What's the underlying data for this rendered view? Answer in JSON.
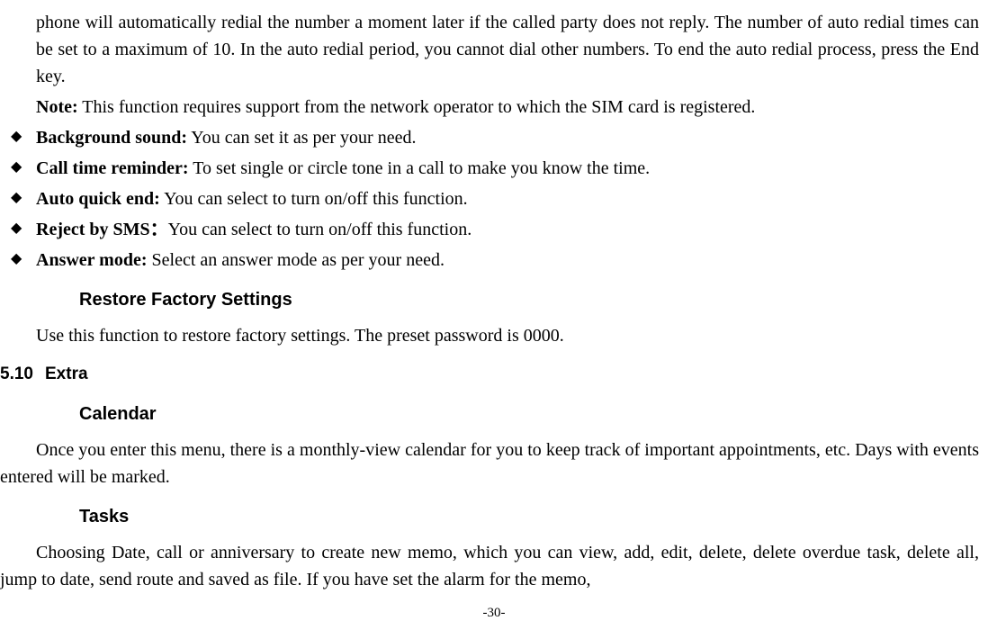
{
  "para1": "phone will automatically redial the number a moment later if the called party does not reply. The number of auto redial times can be set to a maximum of 10. In the auto redial period, you cannot dial other numbers. To end the auto redial process, press the End key.",
  "note_label": "Note:",
  "note_text": " This function requires support from the network operator to which the SIM card is registered.",
  "bullets": [
    {
      "label": "Background sound:",
      "text": " You can set it as per your need."
    },
    {
      "label": "Call time reminder:",
      "text": " To set single or circle tone in a call to make you know the time."
    },
    {
      "label": "Auto quick end:",
      "text": " You can select to turn on/off this function."
    },
    {
      "label": "Reject by SMS：",
      "text": "You can select to turn on/off this function."
    },
    {
      "label": "Answer mode:",
      "text": " Select an answer mode as per your need."
    }
  ],
  "heading_restore": "Restore Factory Settings",
  "restore_para": "Use this function to restore factory settings. The preset password is 0000.",
  "section_num": "5.10",
  "section_title": "Extra",
  "heading_calendar": "Calendar",
  "calendar_para": "Once you enter this menu, there is a monthly-view calendar for you to keep track of important appointments, etc. Days with events entered will be marked.",
  "heading_tasks": "Tasks",
  "tasks_para": "Choosing Date, call or anniversary to create new memo, which you can view, add, edit, delete, delete overdue task, delete all, jump to date, send route and saved as file. If you have set the alarm for the memo,",
  "page_number": "-30-"
}
